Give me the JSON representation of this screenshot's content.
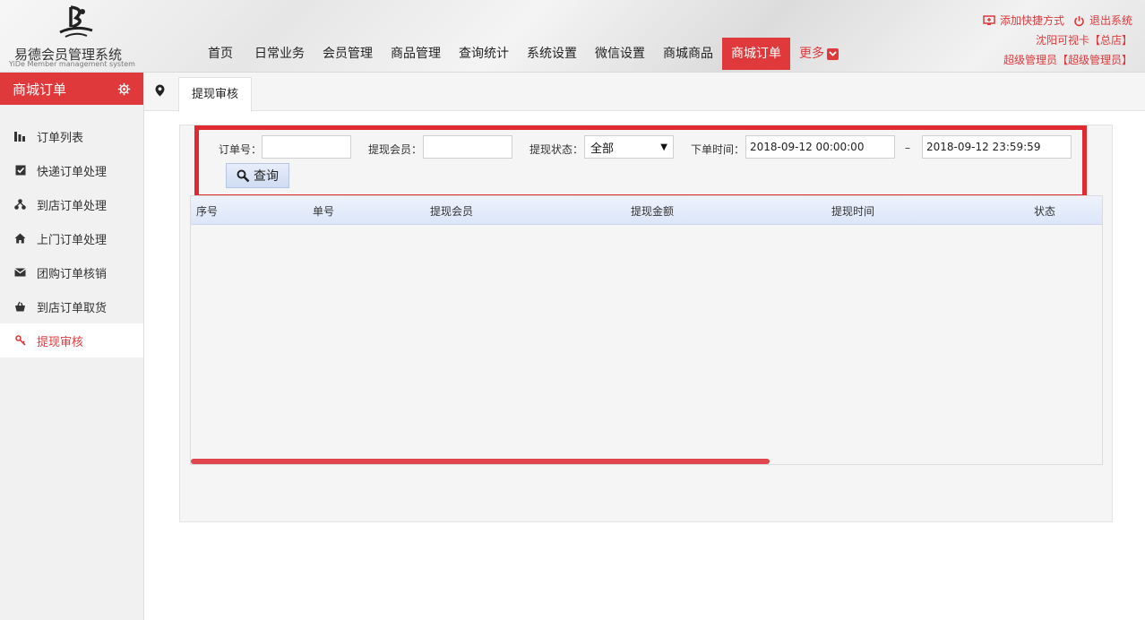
{
  "header": {
    "logo_title": "易德会员管理系统",
    "logo_subtitle": "YiDe Member management system",
    "nav": [
      {
        "label": "首页"
      },
      {
        "label": "日常业务"
      },
      {
        "label": "会员管理"
      },
      {
        "label": "商品管理"
      },
      {
        "label": "查询统计"
      },
      {
        "label": "系统设置"
      },
      {
        "label": "微信设置"
      },
      {
        "label": "商城商品"
      },
      {
        "label": "商城订单",
        "active": true
      },
      {
        "label": "更多"
      }
    ],
    "add_shortcut": "添加快捷方式",
    "logout": "退出系统",
    "store": "沈阳可视卡【总店】",
    "user": "超级管理员【超级管理员】"
  },
  "sidebar": {
    "title": "商城订单",
    "items": [
      {
        "label": "订单列表",
        "icon": "bar-chart-icon"
      },
      {
        "label": "快递订单处理",
        "icon": "checkbox-icon"
      },
      {
        "label": "到店订单处理",
        "icon": "sitemap-icon"
      },
      {
        "label": "上门订单处理",
        "icon": "home-icon"
      },
      {
        "label": "团购订单核销",
        "icon": "envelope-icon"
      },
      {
        "label": "到店订单取货",
        "icon": "basket-icon"
      },
      {
        "label": "提现审核",
        "icon": "key-icon",
        "active": true
      }
    ]
  },
  "tab": {
    "label": "提现审核"
  },
  "filter": {
    "order_no_label": "订单号：",
    "order_no_value": "",
    "member_label": "提现会员：",
    "member_value": "",
    "status_label": "提现状态：",
    "status_value": "全部",
    "time_label": "下单时间：",
    "time_start": "2018-09-12 00:00:00",
    "time_sep": "–",
    "time_end": "2018-09-12 23:59:59",
    "search_label": "查询"
  },
  "table": {
    "columns": [
      "序号",
      "单号",
      "提现会员",
      "提现金额",
      "提现时间",
      "状态"
    ],
    "rows": []
  },
  "colors": {
    "accent": "#e0393c",
    "highlight": "#e02a32"
  }
}
